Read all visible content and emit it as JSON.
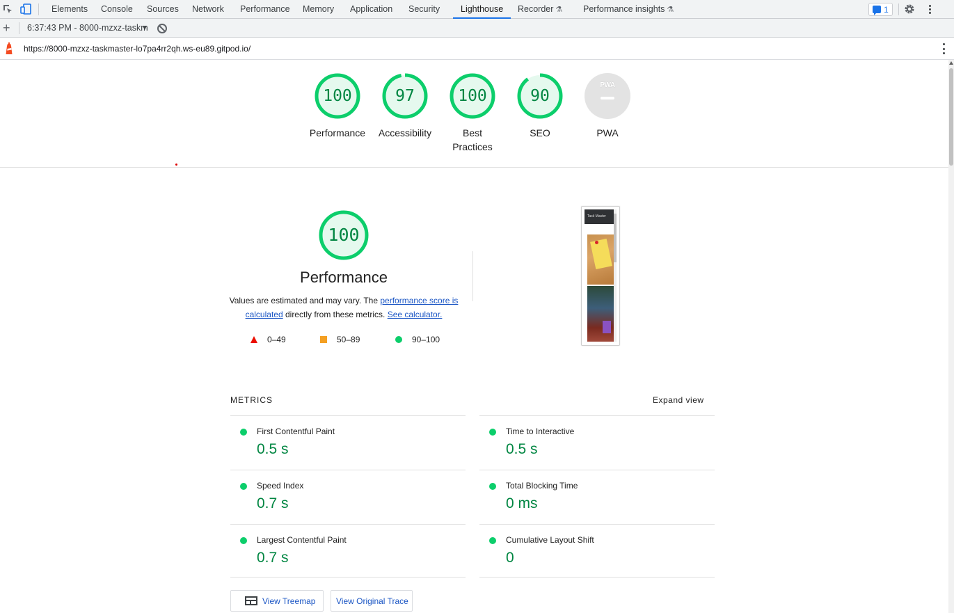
{
  "devtools": {
    "tabs": [
      {
        "label": "Elements"
      },
      {
        "label": "Console"
      },
      {
        "label": "Sources"
      },
      {
        "label": "Network"
      },
      {
        "label": "Performance"
      },
      {
        "label": "Memory"
      },
      {
        "label": "Application"
      },
      {
        "label": "Security"
      },
      {
        "label": "Lighthouse",
        "active": true
      },
      {
        "label": "Recorder",
        "experimental": true
      },
      {
        "label": "Performance insights",
        "experimental": true
      }
    ],
    "issues_count": "1",
    "icons": [
      "inspect-icon",
      "device-toolbar-icon",
      "issues-icon",
      "gear-icon",
      "kebab-menu-icon"
    ]
  },
  "toolbar": {
    "report_label": "6:37:43 PM - 8000-mzxz-taskm",
    "add_icon": "plus-icon",
    "clear_icon": "block-icon"
  },
  "url": "https://8000-mzxz-taskmaster-lo7pa4rr2qh.ws-eu89.gitpod.io/",
  "scores": [
    {
      "label": "Performance",
      "value": "100",
      "fraction": 1.0
    },
    {
      "label": "Accessibility",
      "value": "97",
      "fraction": 0.97
    },
    {
      "label": "Best Practices",
      "value": "100",
      "fraction": 1.0
    },
    {
      "label": "SEO",
      "value": "90",
      "fraction": 0.9
    },
    {
      "label": "PWA",
      "value": "",
      "badge": "PWA"
    }
  ],
  "performance": {
    "score": "100",
    "fraction": 1.0,
    "title": "Performance",
    "desc_prefix": "Values are estimated and may vary. The ",
    "desc_link1": "performance score is calculated",
    "desc_mid": " directly from these metrics. ",
    "desc_link2": "See calculator.",
    "legend": [
      {
        "label": "0–49",
        "shape": "triangle",
        "color": "#eb0f00"
      },
      {
        "label": "50–89",
        "shape": "square",
        "color": "#f4a023"
      },
      {
        "label": "90–100",
        "shape": "circle",
        "color": "#0cce6b"
      }
    ],
    "screenshot_label": "Task Master"
  },
  "metrics": {
    "title": "METRICS",
    "expand": "Expand view",
    "items": [
      {
        "label": "First Contentful Paint",
        "value": "0.5 s"
      },
      {
        "label": "Time to Interactive",
        "value": "0.5 s"
      },
      {
        "label": "Speed Index",
        "value": "0.7 s"
      },
      {
        "label": "Total Blocking Time",
        "value": "0 ms"
      },
      {
        "label": "Largest Contentful Paint",
        "value": "0.7 s"
      },
      {
        "label": "Cumulative Layout Shift",
        "value": "0"
      }
    ]
  },
  "buttons": {
    "treemap": "View Treemap",
    "trace": "View Original Trace"
  },
  "colors": {
    "pass": "#0cce6b",
    "pass_text": "#018642",
    "link": "#1a55c4",
    "accent": "#1a73e8"
  }
}
